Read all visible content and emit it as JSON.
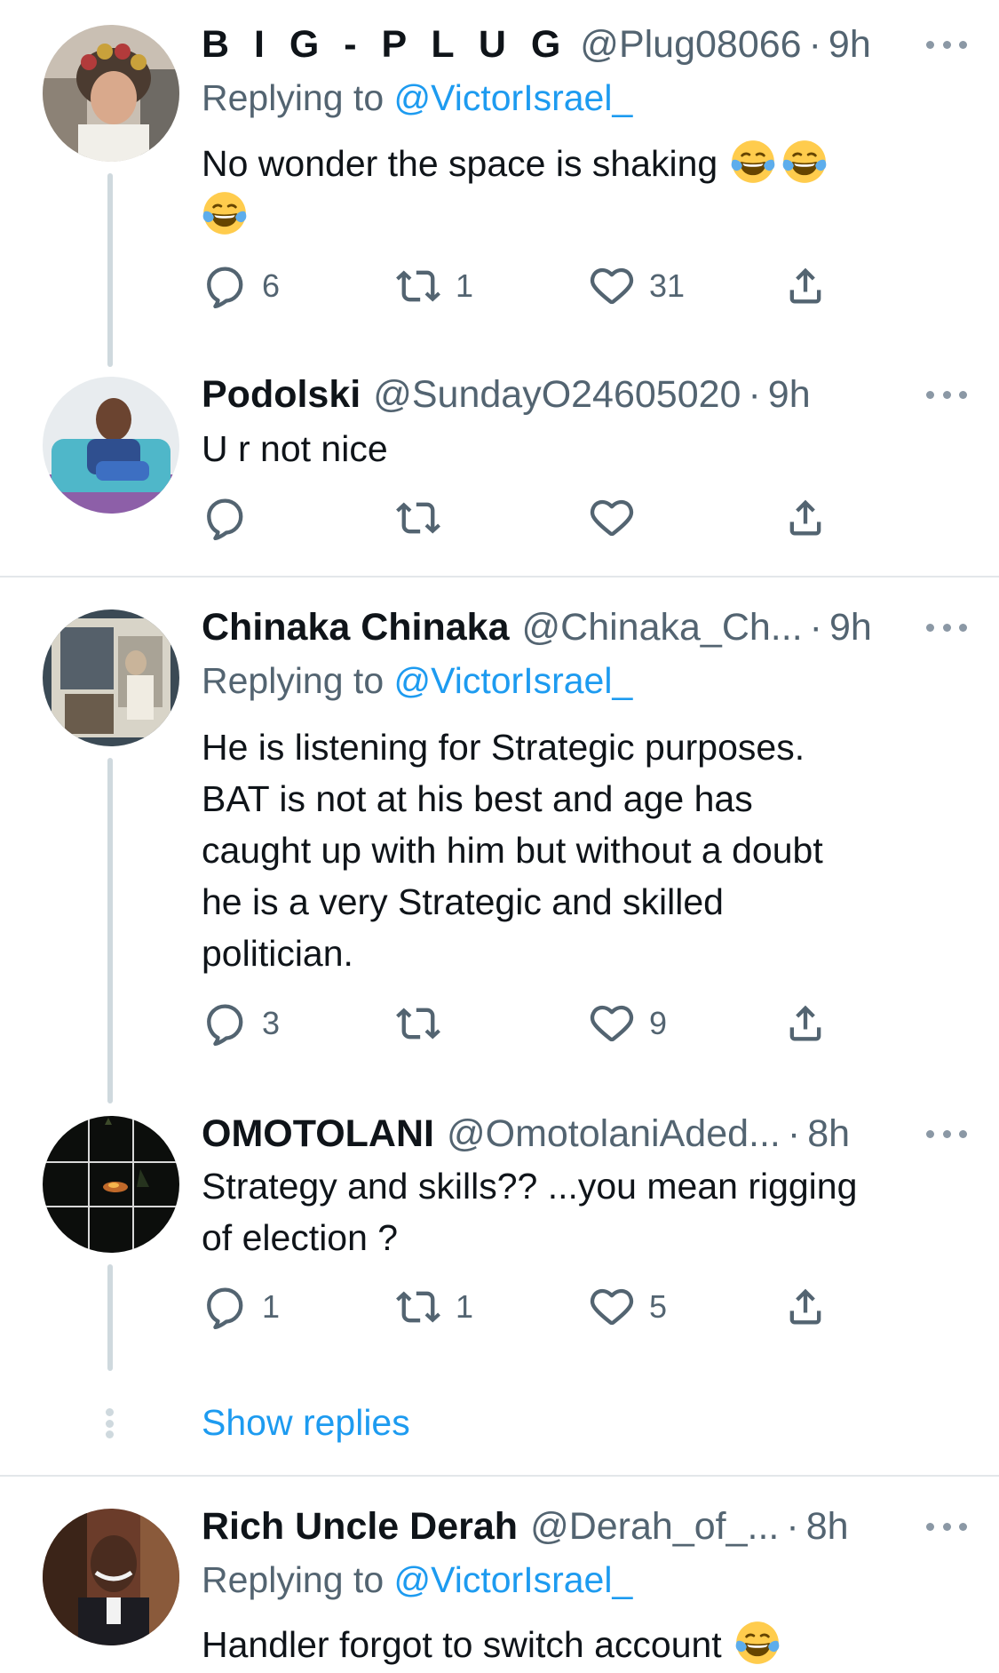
{
  "tweets": [
    {
      "name": "B I G - P L U G",
      "handle": "@Plug08066",
      "time": "9h",
      "replying_label": "Replying to",
      "replying_to": "@VictorIsrael_",
      "text_line1": "No wonder the space is shaking",
      "emoji": "face-with-tears-of-joy",
      "replies": "6",
      "retweets": "1",
      "likes": "31"
    },
    {
      "name": "Podolski",
      "handle": "@SundayO24605020",
      "time": "9h",
      "text_line1": "U r not nice"
    },
    {
      "name": "Chinaka Chinaka",
      "handle": "@Chinaka_Ch...",
      "time": "9h",
      "replying_label": "Replying to",
      "replying_to": "@VictorIsrael_",
      "text_line1": "He is listening for Strategic purposes.",
      "text_line2": "BAT is not at his best and age has",
      "text_line3": "caught up with him but without a doubt",
      "text_line4": "he is a very Strategic and skilled",
      "text_line5": "politician.",
      "replies": "3",
      "likes": "9"
    },
    {
      "name": "OMOTOLANI",
      "handle": "@OmotolaniAded...",
      "time": "8h",
      "text_line1": "Strategy and skills?? ...you mean rigging",
      "text_line2": "of election ?",
      "replies": "1",
      "retweets": "1",
      "likes": "5"
    },
    {
      "name": "Rich Uncle Derah",
      "handle": "@Derah_of_...",
      "time": "8h",
      "replying_label": "Replying to",
      "replying_to": "@VictorIsrael_",
      "text_line1": "Handler forgot to switch account"
    }
  ],
  "show_replies_label": "Show replies",
  "separator": "·",
  "colors": {
    "link": "#1d9bf0",
    "secondary_text": "#536471",
    "thread_line": "#cfd9de"
  },
  "icons": [
    "reply-icon",
    "retweet-icon",
    "like-icon",
    "share-icon",
    "more-icon",
    "tears-of-joy-emoji"
  ]
}
